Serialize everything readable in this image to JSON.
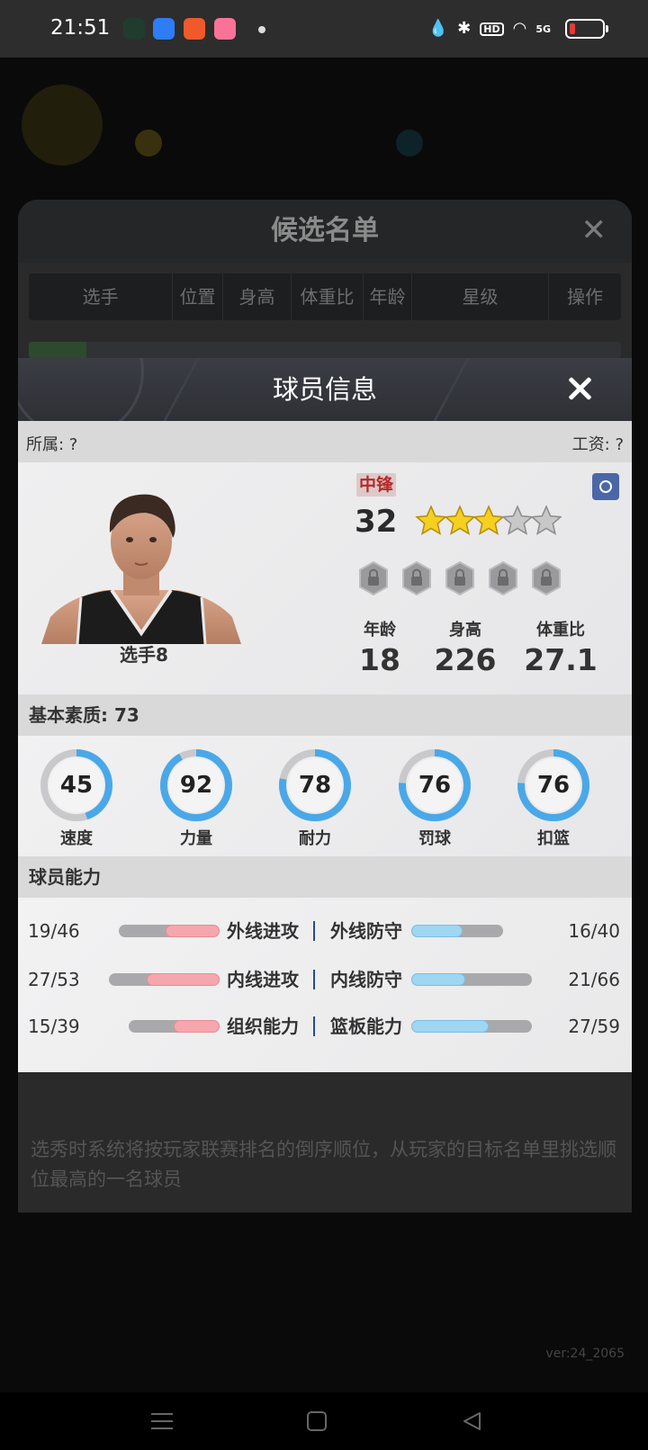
{
  "status_bar": {
    "time": "21:51",
    "apps": [
      {
        "icon": "shield-app-icon",
        "color": "#1f6f4a"
      },
      {
        "icon": "weather-app-icon",
        "color": "#2e7cf6"
      },
      {
        "icon": "video-app-icon",
        "color": "#f0592a"
      },
      {
        "icon": "bilibili-app-icon",
        "color": "#fb7299"
      }
    ],
    "hd": "HD",
    "signal": "5G"
  },
  "candidate_list": {
    "title": "候选名单",
    "columns": [
      "选手",
      "位置",
      "身高",
      "体重比",
      "年龄",
      "星级",
      "操作"
    ],
    "hint": "选秀时系统将按玩家联赛排名的倒序顺位，从玩家的目标名单里挑选顺位最高的一名球员"
  },
  "player": {
    "dialog_title": "球员信息",
    "affiliation": "所属: ?",
    "salary": "工资: ?",
    "name": "选手8",
    "position": "中锋",
    "rating": "32",
    "stars": {
      "total": 5,
      "filled": 3
    },
    "locked_slots": 5,
    "stats": [
      {
        "label": "年龄",
        "value": "18"
      },
      {
        "label": "身高",
        "value": "226"
      },
      {
        "label": "体重比",
        "value": "27.1"
      }
    ],
    "basic_quality": "基本素质: 73",
    "attributes": [
      {
        "label": "速度",
        "value": 45
      },
      {
        "label": "力量",
        "value": 92
      },
      {
        "label": "耐力",
        "value": 78
      },
      {
        "label": "罚球",
        "value": 76
      },
      {
        "label": "扣篮",
        "value": 76
      }
    ],
    "abilities_title": "球员能力",
    "abilities": [
      {
        "left_value": "19/46",
        "left_label": "外线进攻",
        "left_ratio": 0.413,
        "right_label": "外线防守",
        "right_value": "16/40",
        "right_ratio": 0.4
      },
      {
        "left_value": "27/53",
        "left_label": "内线进攻",
        "left_ratio": 0.509,
        "right_label": "内线防守",
        "right_value": "21/66",
        "right_ratio": 0.318
      },
      {
        "left_value": "15/39",
        "left_label": "组织能力",
        "left_ratio": 0.385,
        "right_label": "篮板能力",
        "right_value": "27/59",
        "right_ratio": 0.458
      }
    ]
  },
  "version": "ver:24_2065",
  "colors": {
    "ring_fill": "#4aa8e8",
    "ring_track": "#c9c9cb",
    "position_text": "#b52a2a"
  }
}
